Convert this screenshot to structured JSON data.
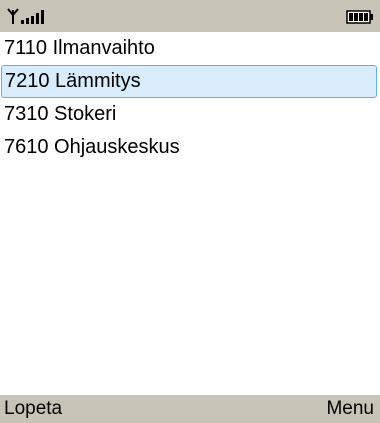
{
  "status_bar": {
    "signal_icon": "signal-strength-icon",
    "battery_icon": "battery-icon"
  },
  "list": {
    "items": [
      {
        "label": "7110 Ilmanvaihto",
        "selected": false
      },
      {
        "label": "7210 Lämmitys",
        "selected": true
      },
      {
        "label": "7310 Stokeri",
        "selected": false
      },
      {
        "label": "7610 Ohjauskeskus",
        "selected": false
      }
    ]
  },
  "softkeys": {
    "left_label": "Lopeta",
    "right_label": "Menu"
  },
  "colors": {
    "bar_background": "#c7c3b7",
    "selection_fill": "#d8ecfc",
    "selection_border": "#6aaedf"
  }
}
